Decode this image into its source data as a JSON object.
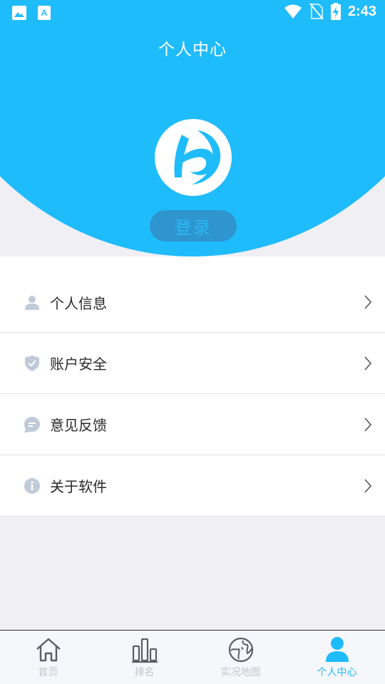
{
  "status_bar": {
    "time": "2:43"
  },
  "header": {
    "title": "个人中心",
    "login_label": "登录"
  },
  "menu": [
    {
      "label": "个人信息",
      "icon": "user-icon"
    },
    {
      "label": "账户安全",
      "icon": "shield-icon"
    },
    {
      "label": "意见反馈",
      "icon": "feedback-icon"
    },
    {
      "label": "关于软件",
      "icon": "info-icon"
    }
  ],
  "tabs": [
    {
      "label": "首页",
      "icon": "home-icon",
      "active": false
    },
    {
      "label": "排名",
      "icon": "bar-chart-icon",
      "active": false
    },
    {
      "label": "实况地图",
      "icon": "globe-icon",
      "active": false
    },
    {
      "label": "个人中心",
      "icon": "profile-icon",
      "active": true
    }
  ],
  "colors": {
    "accent": "#1fbcfb",
    "button": "#2e95cf",
    "icon_gray": "#c1cad8",
    "tab_inactive": "#c3c6cc"
  }
}
